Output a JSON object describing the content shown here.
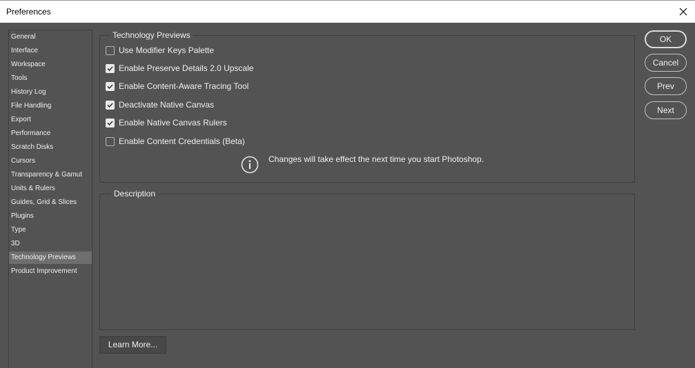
{
  "window": {
    "title": "Preferences"
  },
  "sidebar": {
    "items": [
      {
        "label": "General",
        "selected": false
      },
      {
        "label": "Interface",
        "selected": false
      },
      {
        "label": "Workspace",
        "selected": false
      },
      {
        "label": "Tools",
        "selected": false
      },
      {
        "label": "History Log",
        "selected": false
      },
      {
        "label": "File Handling",
        "selected": false
      },
      {
        "label": "Export",
        "selected": false
      },
      {
        "label": "Performance",
        "selected": false
      },
      {
        "label": "Scratch Disks",
        "selected": false
      },
      {
        "label": "Cursors",
        "selected": false
      },
      {
        "label": "Transparency & Gamut",
        "selected": false
      },
      {
        "label": "Units & Rulers",
        "selected": false
      },
      {
        "label": "Guides, Grid & Slices",
        "selected": false
      },
      {
        "label": "Plugins",
        "selected": false
      },
      {
        "label": "Type",
        "selected": false
      },
      {
        "label": "3D",
        "selected": false
      },
      {
        "label": "Technology Previews",
        "selected": true
      },
      {
        "label": "Product Improvement",
        "selected": false
      }
    ]
  },
  "tech_previews": {
    "title": "Technology Previews",
    "options": [
      {
        "label": "Use Modifier Keys Palette",
        "checked": false
      },
      {
        "label": "Enable Preserve Details 2.0 Upscale",
        "checked": true
      },
      {
        "label": "Enable Content-Aware Tracing Tool",
        "checked": true
      },
      {
        "label": "Deactivate Native Canvas",
        "checked": true
      },
      {
        "label": "Enable Native Canvas Rulers",
        "checked": true
      },
      {
        "label": "Enable Content Credentials (Beta)",
        "checked": false
      }
    ],
    "info_text": "Changes will take effect the next time you start Photoshop."
  },
  "description": {
    "title": "Description",
    "body": ""
  },
  "learn_more_label": "Learn More...",
  "buttons": {
    "ok": "OK",
    "cancel": "Cancel",
    "prev": "Prev",
    "next": "Next"
  },
  "icons": {
    "close": "close-icon",
    "info": "info-icon",
    "check": "checkmark-icon"
  }
}
